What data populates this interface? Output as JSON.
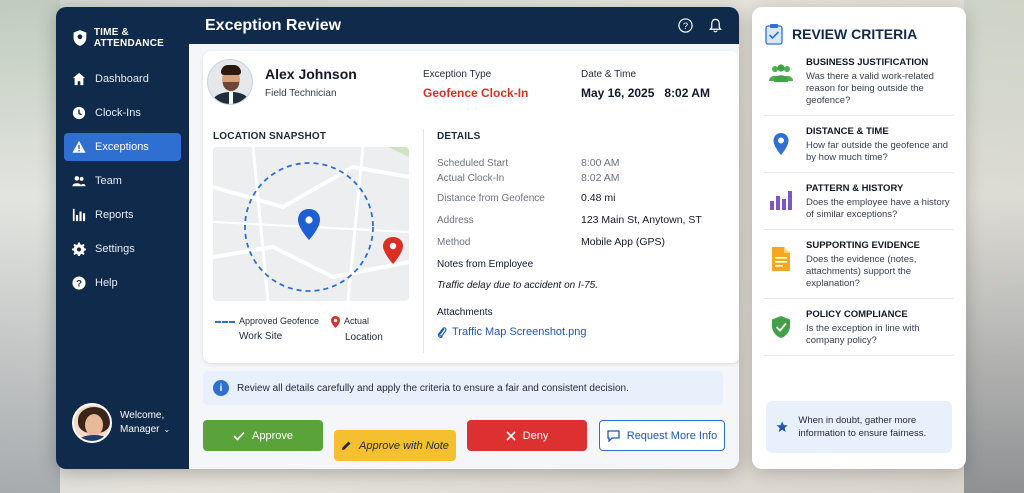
{
  "brand": {
    "name": "TIME & ATTENDANCE"
  },
  "sidebar": {
    "items": [
      {
        "label": "Dashboard",
        "icon": "home-icon",
        "active": false
      },
      {
        "label": "Clock-Ins",
        "icon": "clock-icon",
        "active": false
      },
      {
        "label": "Exceptions",
        "icon": "warning-icon",
        "active": true
      },
      {
        "label": "Team",
        "icon": "team-icon",
        "active": false
      },
      {
        "label": "Reports",
        "icon": "reports-icon",
        "active": false
      },
      {
        "label": "Settings",
        "icon": "gear-icon",
        "active": false
      },
      {
        "label": "Help",
        "icon": "help-icon",
        "active": false
      }
    ],
    "user": {
      "greeting": "Welcome,",
      "name": "Manager"
    }
  },
  "header": {
    "title": "Exception Review"
  },
  "employee": {
    "name": "Alex Johnson",
    "role": "Field Technician"
  },
  "exception": {
    "type_label": "Exception Type",
    "type_value": "Geofence Clock-In",
    "datetime_label": "Date & Time",
    "datetime_value": "May 16, 2025   8:02 AM"
  },
  "location": {
    "title": "LOCATION SNAPSHOT",
    "legend_geofence": "Approved Geofence",
    "legend_geofence_sub": "Work Site",
    "legend_actual": "Actual",
    "legend_actual_sub": "Location"
  },
  "details": {
    "title": "DETAILS",
    "rows": [
      {
        "key": "Scheduled Start",
        "value": "8:00 AM"
      },
      {
        "key": "Actual Clock-In",
        "value": "8:02 AM"
      },
      {
        "key": "Distance from Geofence",
        "value": "0.48 mi"
      },
      {
        "key": "Address",
        "value": "123 Main St, Anytown, ST"
      },
      {
        "key": "Method",
        "value": "Mobile App (GPS)"
      }
    ],
    "notes_label": "Notes from Employee",
    "notes_value": "Traffic delay due to accident on I-75.",
    "attachments_label": "Attachments",
    "attachment": "Traffic Map Screenshot.png"
  },
  "info_text": "Review all details carefully and apply the criteria to ensure a fair and consistent decision.",
  "actions": {
    "approve": "Approve",
    "approve_note": "Approve with Note",
    "deny": "Deny",
    "request_info": "Request More Info"
  },
  "criteria": {
    "title": "REVIEW CRITERIA",
    "items": [
      {
        "title": "BUSINESS JUSTIFICATION",
        "desc": "Was there a valid work-related reason for being outside the geofence?",
        "icon": "team-icon",
        "color": "#4caf50"
      },
      {
        "title": "DISTANCE & TIME",
        "desc": "How far outside the geofence and by how much time?",
        "icon": "location-pin-icon",
        "color": "#2f6fd1"
      },
      {
        "title": "PATTERN & HISTORY",
        "desc": "Does the employee have a history of similar exceptions?",
        "icon": "bar-chart-icon",
        "color": "#7e57c2"
      },
      {
        "title": "SUPPORTING EVIDENCE",
        "desc": "Does the evidence (notes, attachments) support the explanation?",
        "icon": "document-icon",
        "color": "#f5a623"
      },
      {
        "title": "POLICY COMPLIANCE",
        "desc": "Is the exception in line with company policy?",
        "icon": "shield-check-icon",
        "color": "#43a047"
      }
    ],
    "tip": "When in doubt, gather more information to ensure fairness."
  }
}
